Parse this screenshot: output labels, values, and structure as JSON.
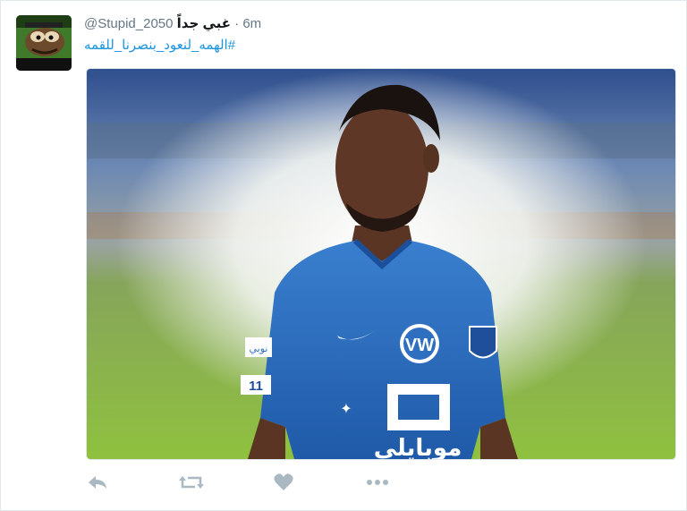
{
  "tweet": {
    "display_name": "غبي جداً",
    "screen_name": "@Stupid_2050",
    "separator": "·",
    "time": "6m",
    "hashtag": "#الهمه_لنعود_بنصرنا_للقمه"
  },
  "media": {
    "kit_sponsor_text": "ﻣﻮﺑﺎﻳﻠﻲ",
    "sleeve_patch_text": "ﻧﻮﺑﻲ",
    "shirt_number": "11"
  },
  "colors": {
    "link": "#1b95e0",
    "action_gray": "#aab8c2",
    "jersey_blue": "#2f6fc0"
  },
  "actions": {
    "reply_icon": "reply-icon",
    "retweet_icon": "retweet-icon",
    "like_icon": "heart-icon",
    "more_icon": "more-icon"
  }
}
